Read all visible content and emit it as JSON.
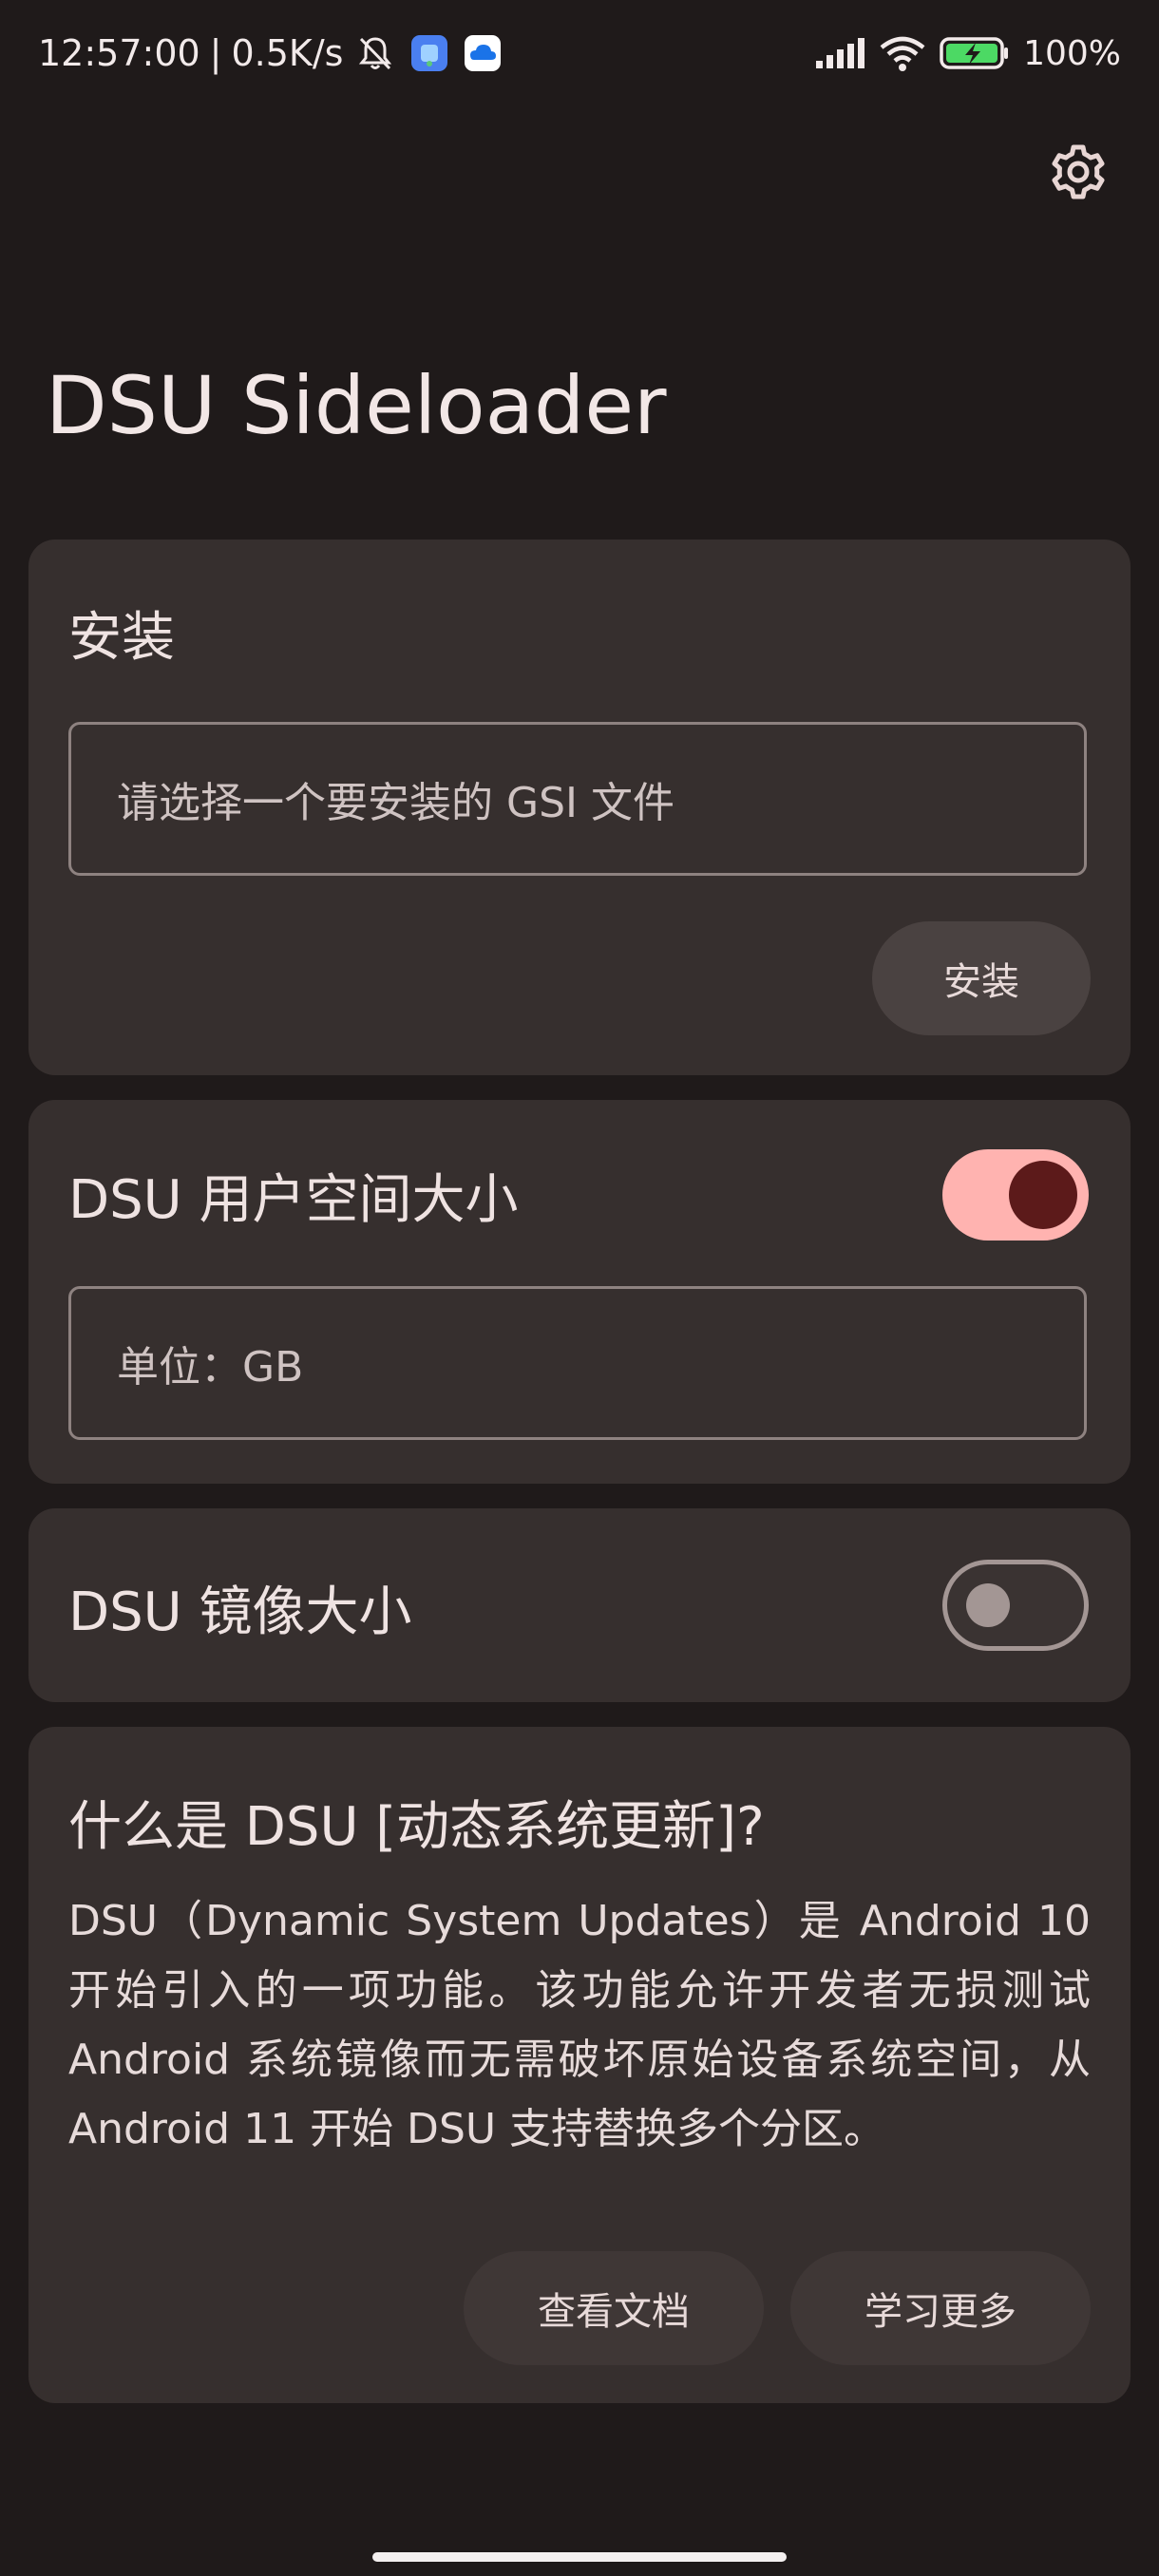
{
  "status_bar": {
    "time": "12:57:00",
    "separator": "|",
    "network_speed": "0.5K/s",
    "battery_percent": "100%",
    "icons": [
      "mute-icon",
      "app-icon-blue",
      "cloud-app-icon",
      "signal-icon",
      "wifi-icon",
      "battery-charging-icon"
    ]
  },
  "header": {
    "settings_icon": "gear-icon",
    "title": "DSU Sideloader"
  },
  "install_card": {
    "title": "安装",
    "file_placeholder": "请选择一个要安装的 GSI 文件",
    "install_button": "安装"
  },
  "userdata_card": {
    "title": "DSU 用户空间大小",
    "switch_on": true,
    "size_placeholder": "单位：GB"
  },
  "image_card": {
    "title": "DSU 镜像大小",
    "switch_on": false
  },
  "about_card": {
    "title": "什么是 DSU [动态系统更新]?",
    "body": "DSU（Dynamic System Updates）是 Android 10 开始引入的一项功能。该功能允许开发者无损测试 Android 系统镜像而无需破坏原始设备系统空间，从 Android 11 开始 DSU 支持替换多个分区。",
    "docs_button": "查看文档",
    "learn_button": "学习更多"
  },
  "colors": {
    "background": "#1f1a1a",
    "card": "#362f2e",
    "switch_on_track": "#ffb3b0",
    "switch_on_thumb": "#5c1a1a",
    "button_tonal": "#4a4241"
  }
}
